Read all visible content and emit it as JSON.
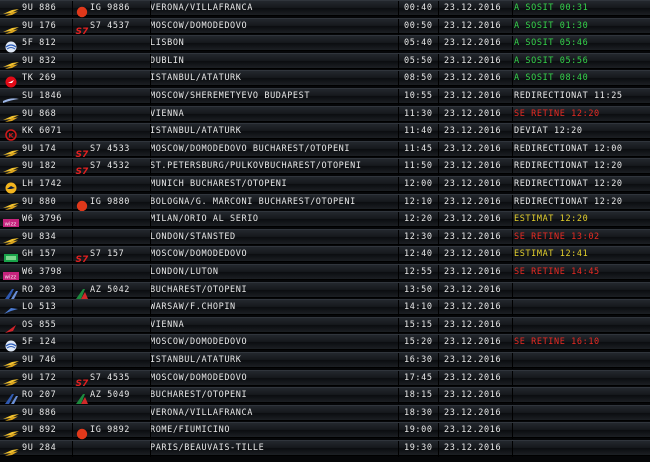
{
  "board": {
    "colors": {
      "departed": "#35d34a",
      "redirected": "#ea2b23",
      "delayed": "#ea2b23",
      "estimated": "#e3cf2c",
      "text": "#e8e8e8"
    },
    "rows": [
      {
        "logo": "airline-chevron-icon",
        "flight": "9U 886",
        "codeshare_logo": "red-dot-icon",
        "codeshare": "IG 9886",
        "destination": "VERONA/VILLAFRANCA",
        "time": "00:40",
        "date": "23.12.2016",
        "status": "A SOSIT 00:31",
        "status_type": "departed"
      },
      {
        "logo": "airline-chevron-icon",
        "flight": "9U 176",
        "codeshare_logo": "s7-logo-icon",
        "codeshare": "S7 4537",
        "destination": "MOSCOW/DOMODEDOVO",
        "time": "00:50",
        "date": "23.12.2016",
        "status": "A SOSIT 01:30",
        "status_type": "departed"
      },
      {
        "logo": "globe-logo-icon",
        "flight": "5F 812",
        "codeshare_logo": "",
        "codeshare": "",
        "destination": "LISBON",
        "time": "05:40",
        "date": "23.12.2016",
        "status": "A SOSIT 05:46",
        "status_type": "departed"
      },
      {
        "logo": "airline-chevron-icon",
        "flight": "9U 832",
        "codeshare_logo": "",
        "codeshare": "",
        "destination": "DUBLIN",
        "time": "05:50",
        "date": "23.12.2016",
        "status": "A SOSIT 05:56",
        "status_type": "departed"
      },
      {
        "logo": "turkish-airlines-icon",
        "flight": "TK 269",
        "codeshare_logo": "",
        "codeshare": "",
        "destination": "ISTANBUL/ATATURK",
        "time": "08:50",
        "date": "23.12.2016",
        "status": "A SOSIT 08:40",
        "status_type": "departed"
      },
      {
        "logo": "wing-logo-icon",
        "flight": "SU 1846",
        "codeshare_logo": "",
        "codeshare": "",
        "destination": "MOSCOW/SHEREMETYEVO BUDAPEST",
        "time": "10:55",
        "date": "23.12.2016",
        "status": "REDIRECTIONAT 11:25",
        "status_type": "redirected"
      },
      {
        "logo": "airline-chevron-icon",
        "flight": "9U 868",
        "codeshare_logo": "",
        "codeshare": "",
        "destination": "VIENNA",
        "time": "11:30",
        "date": "23.12.2016",
        "status": "SE RETINE 12:20",
        "status_type": "delayed"
      },
      {
        "logo": "red-k-logo-icon",
        "flight": "KK 6071",
        "codeshare_logo": "",
        "codeshare": "",
        "destination": "ISTANBUL/ATATURK",
        "time": "11:40",
        "date": "23.12.2016",
        "status": "DEVIAT 12:20",
        "status_type": "redirected"
      },
      {
        "logo": "airline-chevron-icon",
        "flight": "9U 174",
        "codeshare_logo": "s7-logo-icon",
        "codeshare": "S7 4533",
        "destination": "MOSCOW/DOMODEDOVO      BUCHAREST/OTOPENI",
        "time": "11:45",
        "date": "23.12.2016",
        "status": "REDIRECTIONAT 12:00",
        "status_type": "redirected"
      },
      {
        "logo": "airline-chevron-icon",
        "flight": "9U 182",
        "codeshare_logo": "s7-logo-icon",
        "codeshare": "S7 4532",
        "destination": "ST.PETERSBURG/PULKOVBUCHAREST/OTOPENI",
        "time": "11:50",
        "date": "23.12.2016",
        "status": "REDIRECTIONAT 12:20",
        "status_type": "redirected"
      },
      {
        "logo": "crane-logo-icon",
        "flight": "LH 1742",
        "codeshare_logo": "",
        "codeshare": "",
        "destination": "MUNICH                  BUCHAREST/OTOPENI",
        "time": "12:00",
        "date": "23.12.2016",
        "status": "REDIRECTIONAT 12:20",
        "status_type": "redirected"
      },
      {
        "logo": "airline-chevron-icon",
        "flight": "9U 880",
        "codeshare_logo": "red-dot-icon",
        "codeshare": "IG 9880",
        "destination": "BOLOGNA/G. MARCONI      BUCHAREST/OTOPENI",
        "time": "12:10",
        "date": "23.12.2016",
        "status": "REDIRECTIONAT 12:20",
        "status_type": "redirected"
      },
      {
        "logo": "wizz-logo-icon",
        "flight": "W6 3796",
        "codeshare_logo": "",
        "codeshare": "",
        "destination": "MILAN/ORIO AL SERIO",
        "time": "12:20",
        "date": "23.12.2016",
        "status": "ESTIMAT 12:20",
        "status_type": "estimated"
      },
      {
        "logo": "airline-chevron-icon",
        "flight": "9U 834",
        "codeshare_logo": "",
        "codeshare": "",
        "destination": "LONDON/STANSTED",
        "time": "12:30",
        "date": "23.12.2016",
        "status": "SE RETINE 13:02",
        "status_type": "delayed"
      },
      {
        "logo": "green-logo-icon",
        "flight": "GH 157",
        "codeshare_logo": "s7-logo-icon",
        "codeshare": "S7 157",
        "destination": "MOSCOW/DOMODEDOVO",
        "time": "12:40",
        "date": "23.12.2016",
        "status": "ESTIMAT 12:41",
        "status_type": "estimated"
      },
      {
        "logo": "wizz-logo-icon",
        "flight": "W6 3798",
        "codeshare_logo": "",
        "codeshare": "",
        "destination": "LONDON/LUTON",
        "time": "12:55",
        "date": "23.12.2016",
        "status": "SE RETINE 14:45",
        "status_type": "delayed"
      },
      {
        "logo": "tarom-logo-icon",
        "flight": "RO 203",
        "codeshare_logo": "alitalia-logo-icon",
        "codeshare": "AZ 5042",
        "destination": "BUCHAREST/OTOPENI",
        "time": "13:50",
        "date": "23.12.2016",
        "status": "",
        "status_type": "none"
      },
      {
        "logo": "lot-logo-icon",
        "flight": "LO 513",
        "codeshare_logo": "",
        "codeshare": "",
        "destination": "WARSAW/F.CHOPIN",
        "time": "14:10",
        "date": "23.12.2016",
        "status": "",
        "status_type": "none"
      },
      {
        "logo": "austrian-logo-icon",
        "flight": "OS 855",
        "codeshare_logo": "",
        "codeshare": "",
        "destination": "VIENNA",
        "time": "15:15",
        "date": "23.12.2016",
        "status": "",
        "status_type": "none"
      },
      {
        "logo": "globe-logo-icon",
        "flight": "5F 124",
        "codeshare_logo": "",
        "codeshare": "",
        "destination": "MOSCOW/DOMODEDOVO",
        "time": "15:20",
        "date": "23.12.2016",
        "status": "SE RETINE 16:10",
        "status_type": "delayed"
      },
      {
        "logo": "airline-chevron-icon",
        "flight": "9U 746",
        "codeshare_logo": "",
        "codeshare": "",
        "destination": "ISTANBUL/ATATURK",
        "time": "16:30",
        "date": "23.12.2016",
        "status": "",
        "status_type": "none"
      },
      {
        "logo": "airline-chevron-icon",
        "flight": "9U 172",
        "codeshare_logo": "s7-logo-icon",
        "codeshare": "S7 4535",
        "destination": "MOSCOW/DOMODEDOVO",
        "time": "17:45",
        "date": "23.12.2016",
        "status": "",
        "status_type": "none"
      },
      {
        "logo": "tarom-logo-icon",
        "flight": "RO 207",
        "codeshare_logo": "alitalia-logo-icon",
        "codeshare": "AZ 5049",
        "destination": "BUCHAREST/OTOPENI",
        "time": "18:15",
        "date": "23.12.2016",
        "status": "",
        "status_type": "none"
      },
      {
        "logo": "airline-chevron-icon",
        "flight": "9U 886",
        "codeshare_logo": "",
        "codeshare": "",
        "destination": "VERONA/VILLAFRANCA",
        "time": "18:30",
        "date": "23.12.2016",
        "status": "",
        "status_type": "none"
      },
      {
        "logo": "airline-chevron-icon",
        "flight": "9U 892",
        "codeshare_logo": "red-dot-icon",
        "codeshare": "IG 9892",
        "destination": "ROME/FIUMICINO",
        "time": "19:00",
        "date": "23.12.2016",
        "status": "",
        "status_type": "none"
      },
      {
        "logo": "airline-chevron-icon",
        "flight": "9U 284",
        "codeshare_logo": "",
        "codeshare": "",
        "destination": "PARIS/BEAUVAIS-TILLE",
        "time": "19:30",
        "date": "23.12.2016",
        "status": "",
        "status_type": "none"
      }
    ]
  }
}
